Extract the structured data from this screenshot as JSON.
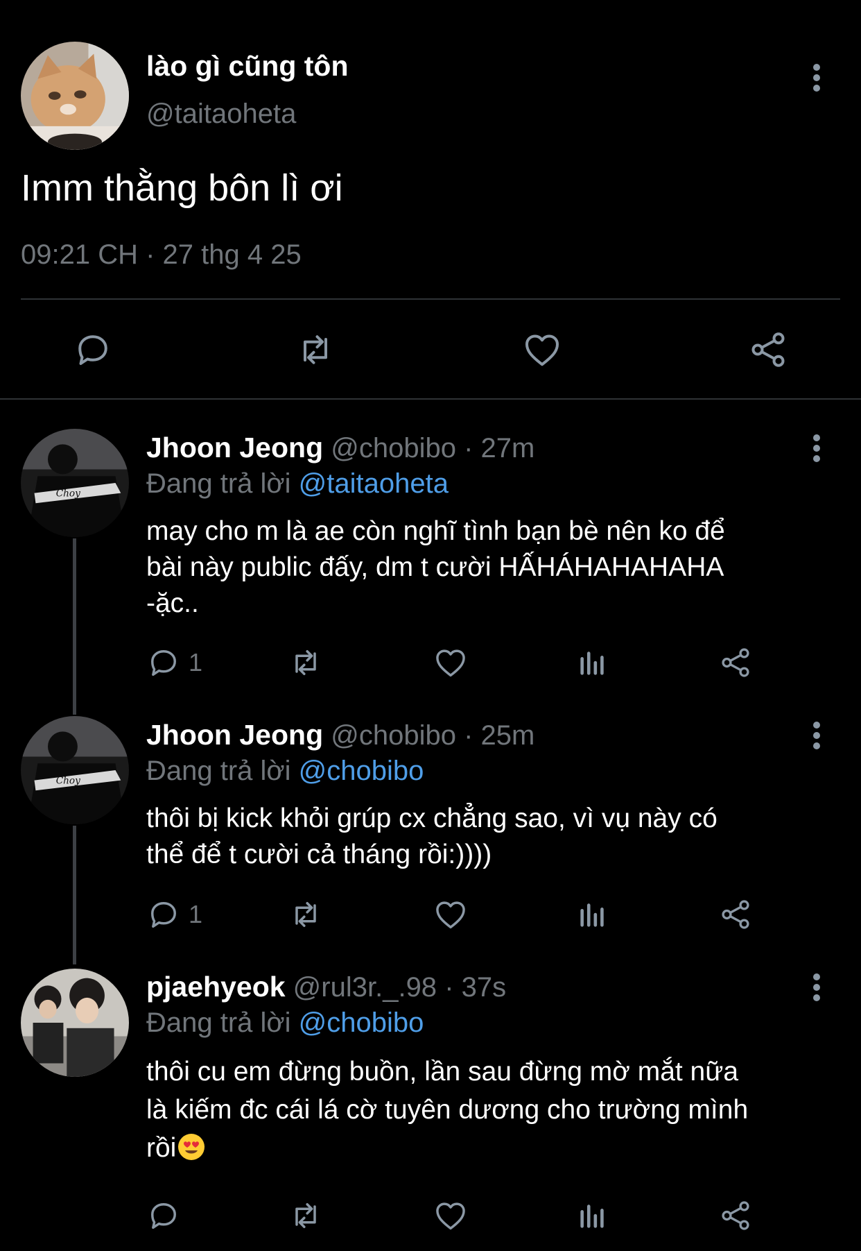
{
  "main_tweet": {
    "author_name": "lào gì cũng tôn",
    "author_handle": "@taitaoheta",
    "text": "Imm thằng bôn lì ơi",
    "timestamp": "09:21 CH · 27 thg 4 25",
    "avatar": "cat-photo"
  },
  "replies": [
    {
      "author_name": "Jhoon Jeong",
      "author_handle": "@chobibo",
      "separator": "·",
      "time": "27m",
      "replying_prefix": "Đang trả lời",
      "replying_to": "@taitaoheta",
      "lines": [
        "may cho m là ae còn nghĩ tình bạn bè nên ko để",
        "bài này public đấy, dm t cười HẤHÁHAHAHAHA",
        "-ặc.."
      ],
      "reply_count": "1",
      "avatar": "jacket-photo"
    },
    {
      "author_name": "Jhoon Jeong",
      "author_handle": "@chobibo",
      "separator": "·",
      "time": "25m",
      "replying_prefix": "Đang trả lời",
      "replying_to": "@chobibo",
      "lines": [
        "thôi bị kick khỏi grúp cx chẳng sao, vì vụ này có",
        "thể để t cười cả tháng rồi:))))"
      ],
      "reply_count": "1",
      "avatar": "jacket-photo"
    },
    {
      "author_name": "pjaehyeok",
      "author_handle": "@rul3r._.98",
      "separator": "·",
      "time": "37s",
      "replying_prefix": "Đang trả lời",
      "replying_to": "@chobibo",
      "lines": [
        "thôi cu em đừng buồn, lần sau đừng mờ mắt nữa",
        "là kiếm đc cái lá cờ tuyên dương cho trường mình",
        "rồi"
      ],
      "reply_count": "",
      "avatar": "two-people-photo",
      "trailing_emoji": "heart-eyes-emoji"
    }
  ],
  "icons": {
    "reply": "reply-icon",
    "retweet": "retweet-icon",
    "like": "like-icon",
    "views": "views-icon",
    "share": "share-icon",
    "more": "more-icon"
  },
  "colors": {
    "background": "#000000",
    "text": "#ffffff",
    "muted": "#71767b",
    "link": "#4f9ee8",
    "divider": "#2f3336"
  }
}
